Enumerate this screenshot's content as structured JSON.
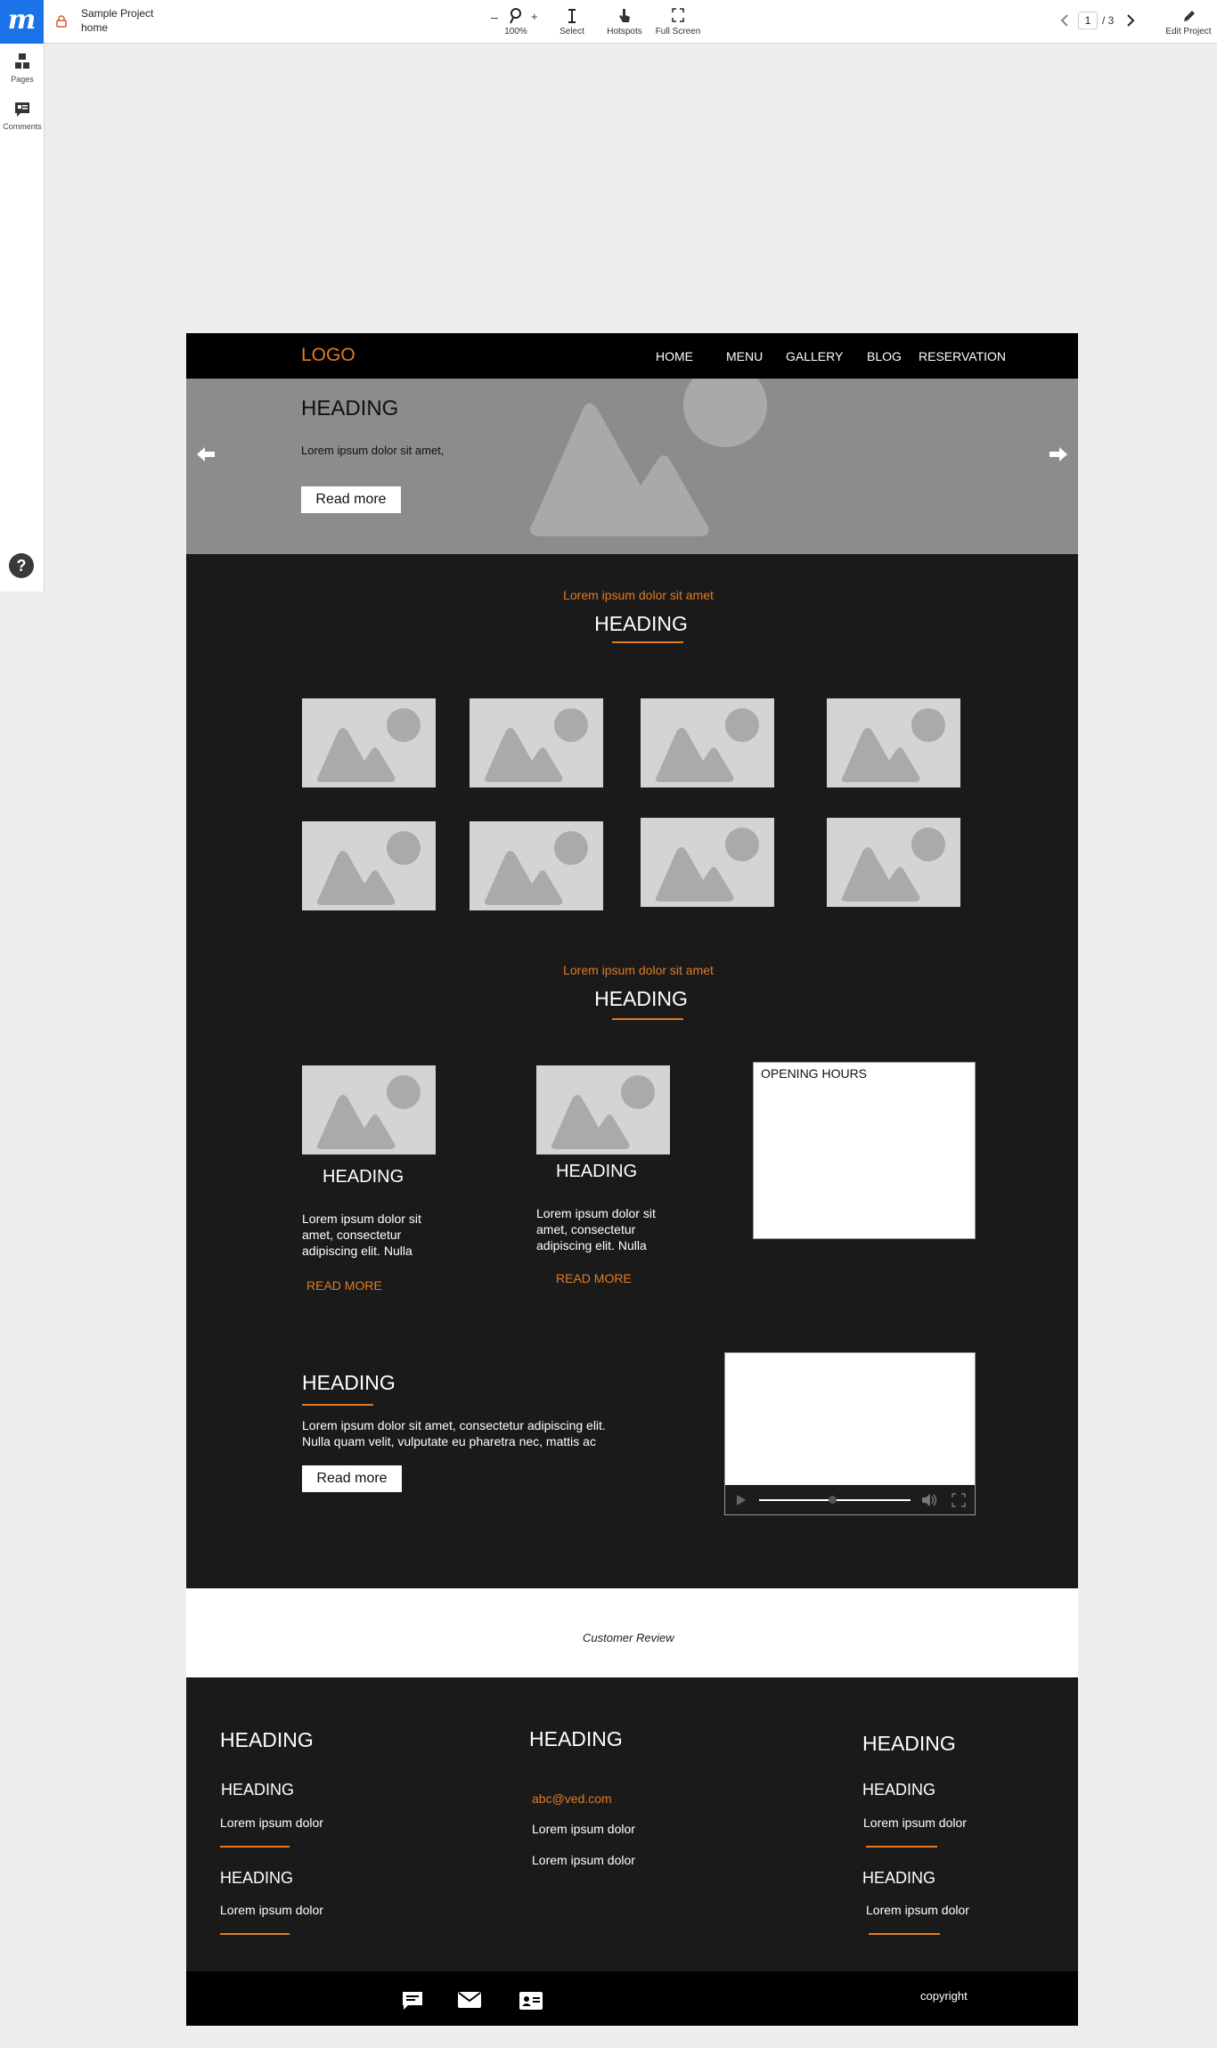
{
  "viewer": {
    "brand": "m",
    "project_name": "Sample Project",
    "page_name": "home",
    "zoom_minus": "–",
    "zoom_plus": "+",
    "zoom_level": "100%",
    "tools": {
      "select": "Select",
      "hotspots": "Hotspots",
      "fullscreen": "Full Screen"
    },
    "page_current": "1",
    "page_total": "/ 3",
    "edit_project": "Edit Project",
    "sidebar": {
      "pages": "Pages",
      "comments": "Comments"
    },
    "help": "?"
  },
  "site": {
    "logo": "LOGO",
    "nav": [
      "HOME",
      "MENU",
      "GALLERY",
      "BLOG",
      "RESERVATION"
    ],
    "hero": {
      "heading": "HEADING",
      "text": "Lorem ipsum dolor sit amet,",
      "button": "Read more"
    },
    "gallery": {
      "kicker": "Lorem ipsum dolor sit amet",
      "heading": "HEADING"
    },
    "features": {
      "kicker": "Lorem ipsum dolor sit amet",
      "heading": "HEADING",
      "cards": [
        {
          "heading": "HEADING",
          "text": "Lorem ipsum dolor sit amet, consectetur adipiscing elit. Nulla",
          "link": "READ MORE"
        },
        {
          "heading": "HEADING",
          "text": "Lorem ipsum dolor sit amet, consectetur adipiscing elit. Nulla",
          "link": "READ MORE"
        }
      ],
      "opening_hours": "OPENING HOURS"
    },
    "promo": {
      "heading": "HEADING",
      "text": "Lorem ipsum dolor sit amet, consectetur adipiscing elit. Nulla quam velit, vulputate eu pharetra nec, mattis ac",
      "button": "Read more",
      "video_progress": 0.48
    },
    "review": "Customer Review",
    "footer": {
      "col1": {
        "heading": "HEADING",
        "sub1": "HEADING",
        "text1": "Lorem ipsum dolor",
        "sub2": "HEADING",
        "text2": "Lorem ipsum dolor"
      },
      "col2": {
        "heading": "HEADING",
        "email": "abc@ved.com",
        "text1": "Lorem ipsum dolor",
        "text2": "Lorem ipsum dolor"
      },
      "col3": {
        "heading": "HEADING",
        "sub1": "HEADING",
        "text1": "Lorem ipsum dolor",
        "sub2": "HEADING",
        "text2": "Lorem ipsum dolor"
      }
    },
    "copyright": "copyright"
  },
  "colors": {
    "accent": "#e07b24",
    "viewer_brand": "#1a73e8",
    "dark": "#1a1a1a"
  },
  "icons": [
    "lock-icon",
    "zoom-icon",
    "select-cursor-icon",
    "hotspot-hand-icon",
    "fullscreen-icon",
    "chevron-left-icon",
    "chevron-right-icon",
    "pencil-icon",
    "pages-icon",
    "comments-icon",
    "help-icon",
    "arrow-left-icon",
    "arrow-right-icon",
    "play-icon",
    "volume-icon",
    "chat-icon",
    "mail-icon",
    "contact-card-icon"
  ]
}
